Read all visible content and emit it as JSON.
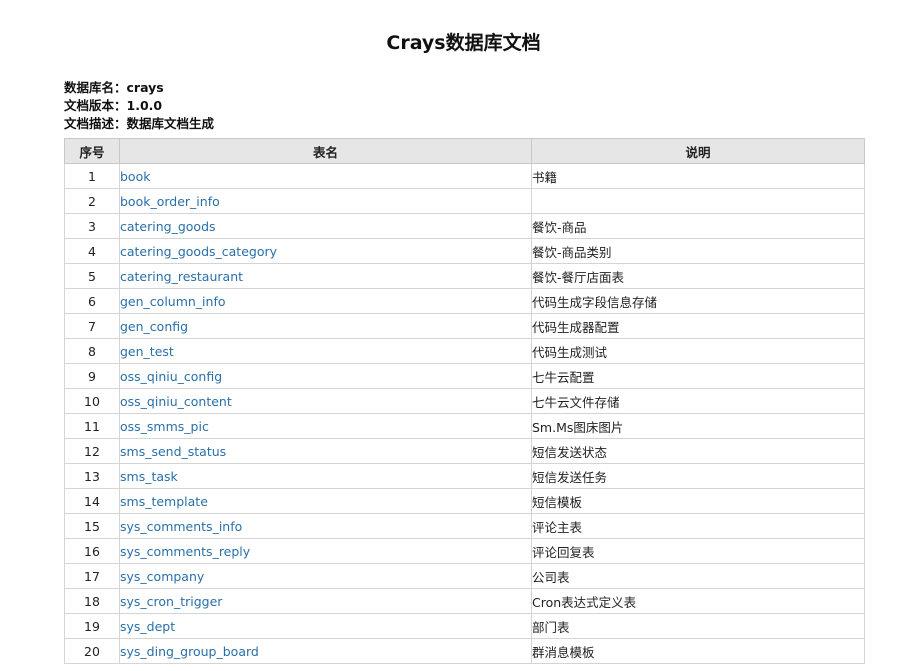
{
  "title": "Crays数据库文档",
  "meta": {
    "db_name_label": "数据库名：",
    "db_name": "crays",
    "version_label": "文档版本：",
    "version": "1.0.0",
    "desc_label": "文档描述：",
    "desc": "数据库文档生成"
  },
  "table": {
    "headers": {
      "no": "序号",
      "name": "表名",
      "desc": "说明"
    },
    "rows": [
      {
        "no": "1",
        "name": "book",
        "desc": "书籍"
      },
      {
        "no": "2",
        "name": "book_order_info",
        "desc": ""
      },
      {
        "no": "3",
        "name": "catering_goods",
        "desc": "餐饮-商品"
      },
      {
        "no": "4",
        "name": "catering_goods_category",
        "desc": "餐饮-商品类别"
      },
      {
        "no": "5",
        "name": "catering_restaurant",
        "desc": "餐饮-餐厅店面表"
      },
      {
        "no": "6",
        "name": "gen_column_info",
        "desc": "代码生成字段信息存储"
      },
      {
        "no": "7",
        "name": "gen_config",
        "desc": "代码生成器配置"
      },
      {
        "no": "8",
        "name": "gen_test",
        "desc": "代码生成测试"
      },
      {
        "no": "9",
        "name": "oss_qiniu_config",
        "desc": "七牛云配置"
      },
      {
        "no": "10",
        "name": "oss_qiniu_content",
        "desc": "七牛云文件存储"
      },
      {
        "no": "11",
        "name": "oss_smms_pic",
        "desc": "Sm.Ms图床图片"
      },
      {
        "no": "12",
        "name": "sms_send_status",
        "desc": "短信发送状态"
      },
      {
        "no": "13",
        "name": "sms_task",
        "desc": "短信发送任务"
      },
      {
        "no": "14",
        "name": "sms_template",
        "desc": "短信模板"
      },
      {
        "no": "15",
        "name": "sys_comments_info",
        "desc": "评论主表"
      },
      {
        "no": "16",
        "name": "sys_comments_reply",
        "desc": "评论回复表"
      },
      {
        "no": "17",
        "name": "sys_company",
        "desc": "公司表"
      },
      {
        "no": "18",
        "name": "sys_cron_trigger",
        "desc": "Cron表达式定义表"
      },
      {
        "no": "19",
        "name": "sys_dept",
        "desc": "部门表"
      },
      {
        "no": "20",
        "name": "sys_ding_group_board",
        "desc": "群消息模板"
      }
    ]
  }
}
